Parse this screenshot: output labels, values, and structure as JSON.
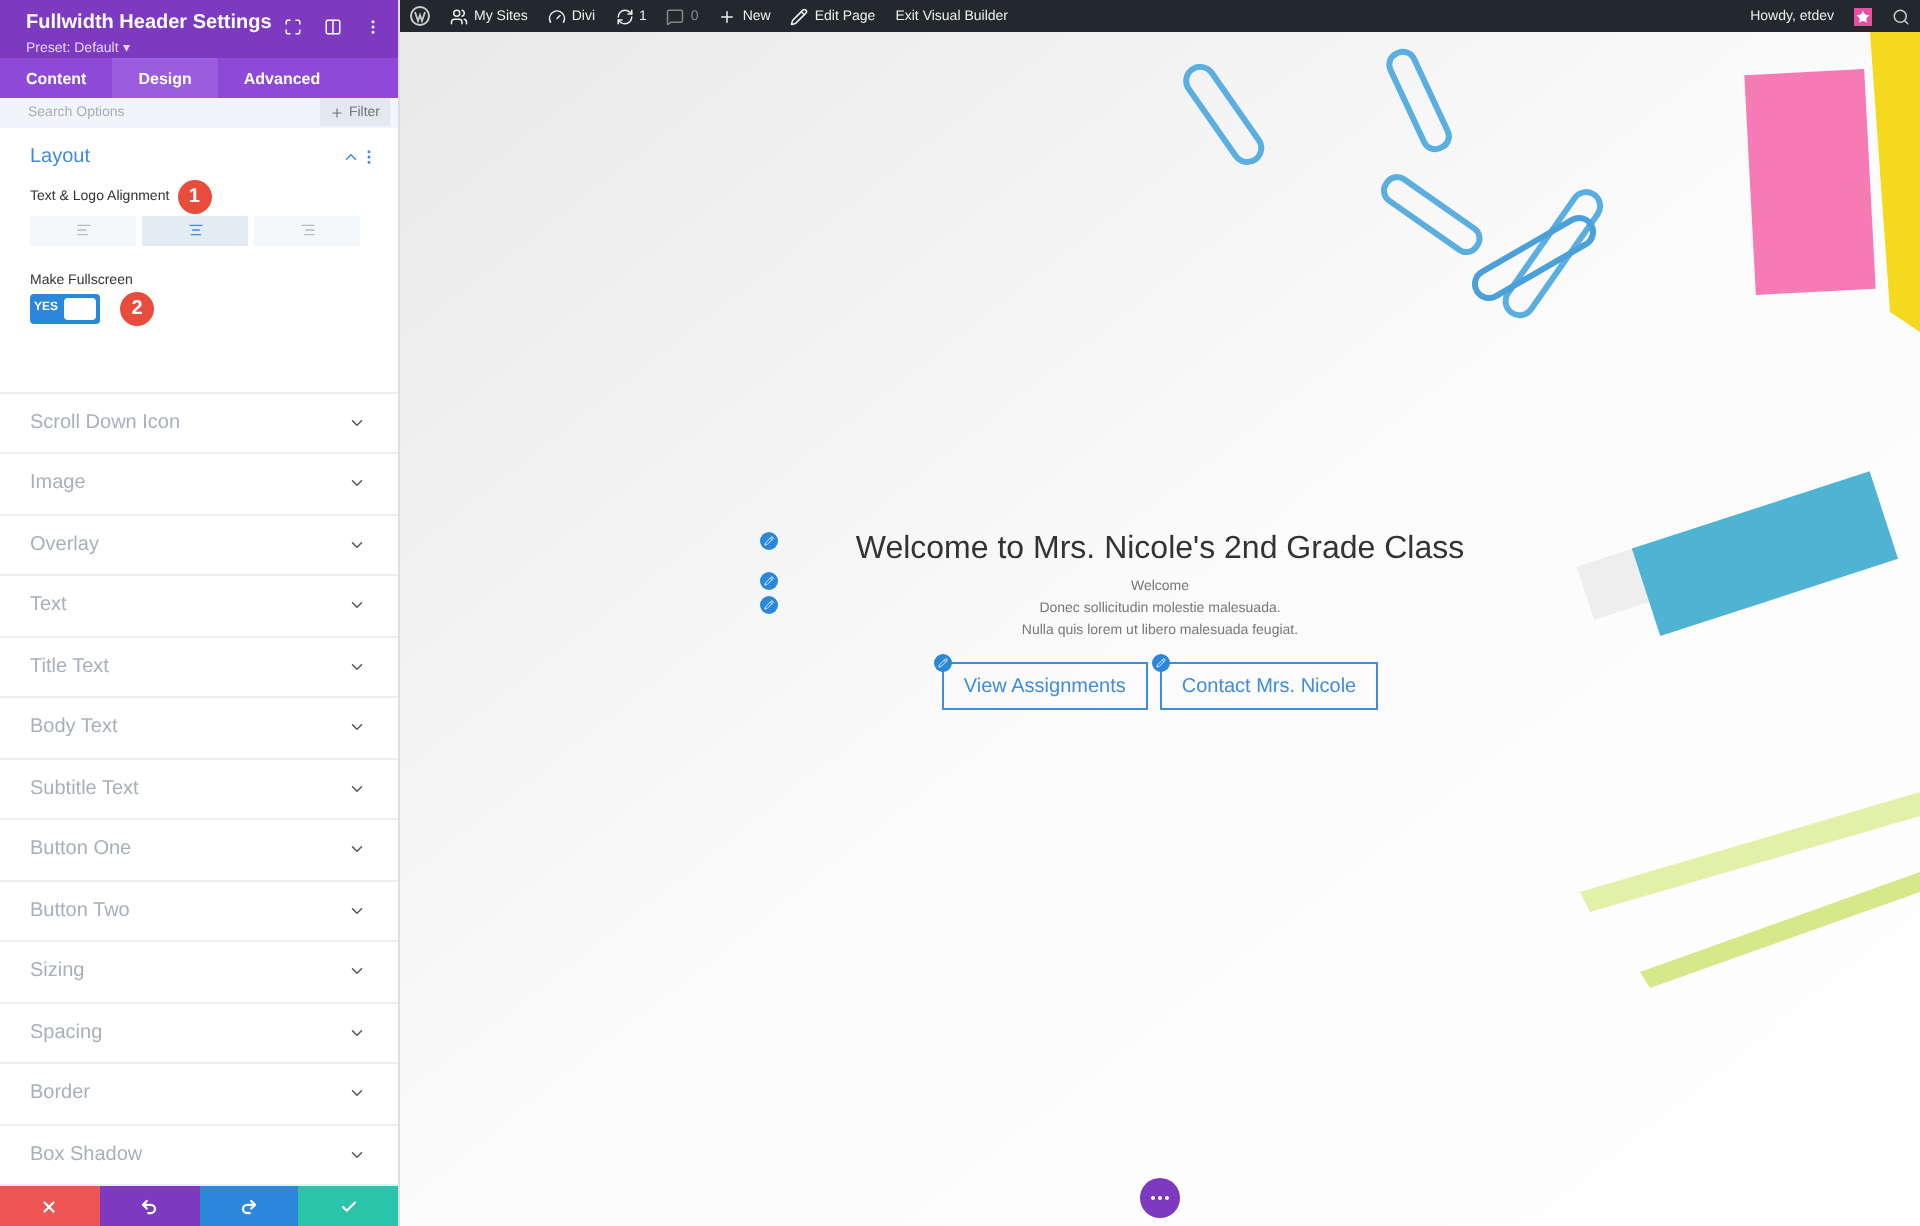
{
  "panel": {
    "title": "Fullwidth Header Settings",
    "preset": "Preset: Default",
    "preset_caret": "▾",
    "tabs": [
      {
        "label": "Content",
        "selected": false
      },
      {
        "label": "Design",
        "selected": true
      },
      {
        "label": "Advanced",
        "selected": false
      }
    ],
    "search": {
      "placeholder": "Search Options"
    },
    "filter_button": "Filter",
    "layout": {
      "title": "Layout",
      "expanded": true,
      "alignment_label": "Text & Logo Alignment",
      "alignment_badge": "1",
      "alignments": [
        {
          "kind": "left",
          "selected": false
        },
        {
          "kind": "center",
          "selected": true
        },
        {
          "kind": "right",
          "selected": false
        }
      ],
      "fullscreen_label": "Make Fullscreen",
      "fullscreen": {
        "on": true,
        "text": "YES"
      },
      "fullscreen_badge": "2"
    },
    "toggles": [
      {
        "label": "Scroll Down Icon"
      },
      {
        "label": "Image"
      },
      {
        "label": "Overlay"
      },
      {
        "label": "Text"
      },
      {
        "label": "Title Text"
      },
      {
        "label": "Body Text"
      },
      {
        "label": "Subtitle Text"
      },
      {
        "label": "Button One"
      },
      {
        "label": "Button Two"
      },
      {
        "label": "Sizing"
      },
      {
        "label": "Spacing"
      },
      {
        "label": "Border"
      },
      {
        "label": "Box Shadow"
      }
    ],
    "actions": [
      {
        "kind": "discard"
      },
      {
        "kind": "undo"
      },
      {
        "kind": "redo"
      },
      {
        "kind": "save"
      }
    ]
  },
  "admin_bar": {
    "items": [
      {
        "kind": "sites",
        "label": "My Sites",
        "disabled": false
      },
      {
        "kind": "divi",
        "label": "Divi",
        "disabled": false
      },
      {
        "kind": "updates",
        "label": "1",
        "disabled": false
      },
      {
        "kind": "comments",
        "label": "0",
        "disabled": true
      },
      {
        "kind": "new",
        "label": "New",
        "disabled": false
      },
      {
        "kind": "edit",
        "label": "Edit Page",
        "disabled": false
      },
      {
        "kind": "plain",
        "label": "Exit Visual Builder",
        "disabled": false
      }
    ],
    "greeting": "Howdy, etdev"
  },
  "hero": {
    "kind": "picture",
    "title": "Welcome to Mrs. Nicole's 2nd Grade Class",
    "subtitle": "Welcome",
    "body": [
      "Donec sollicitudin molestie malesuada.",
      "Nulla quis lorem ut libero malesuada feugiat."
    ],
    "buttons": [
      "View Assignments",
      "Contact Mrs. Nicole"
    ]
  }
}
